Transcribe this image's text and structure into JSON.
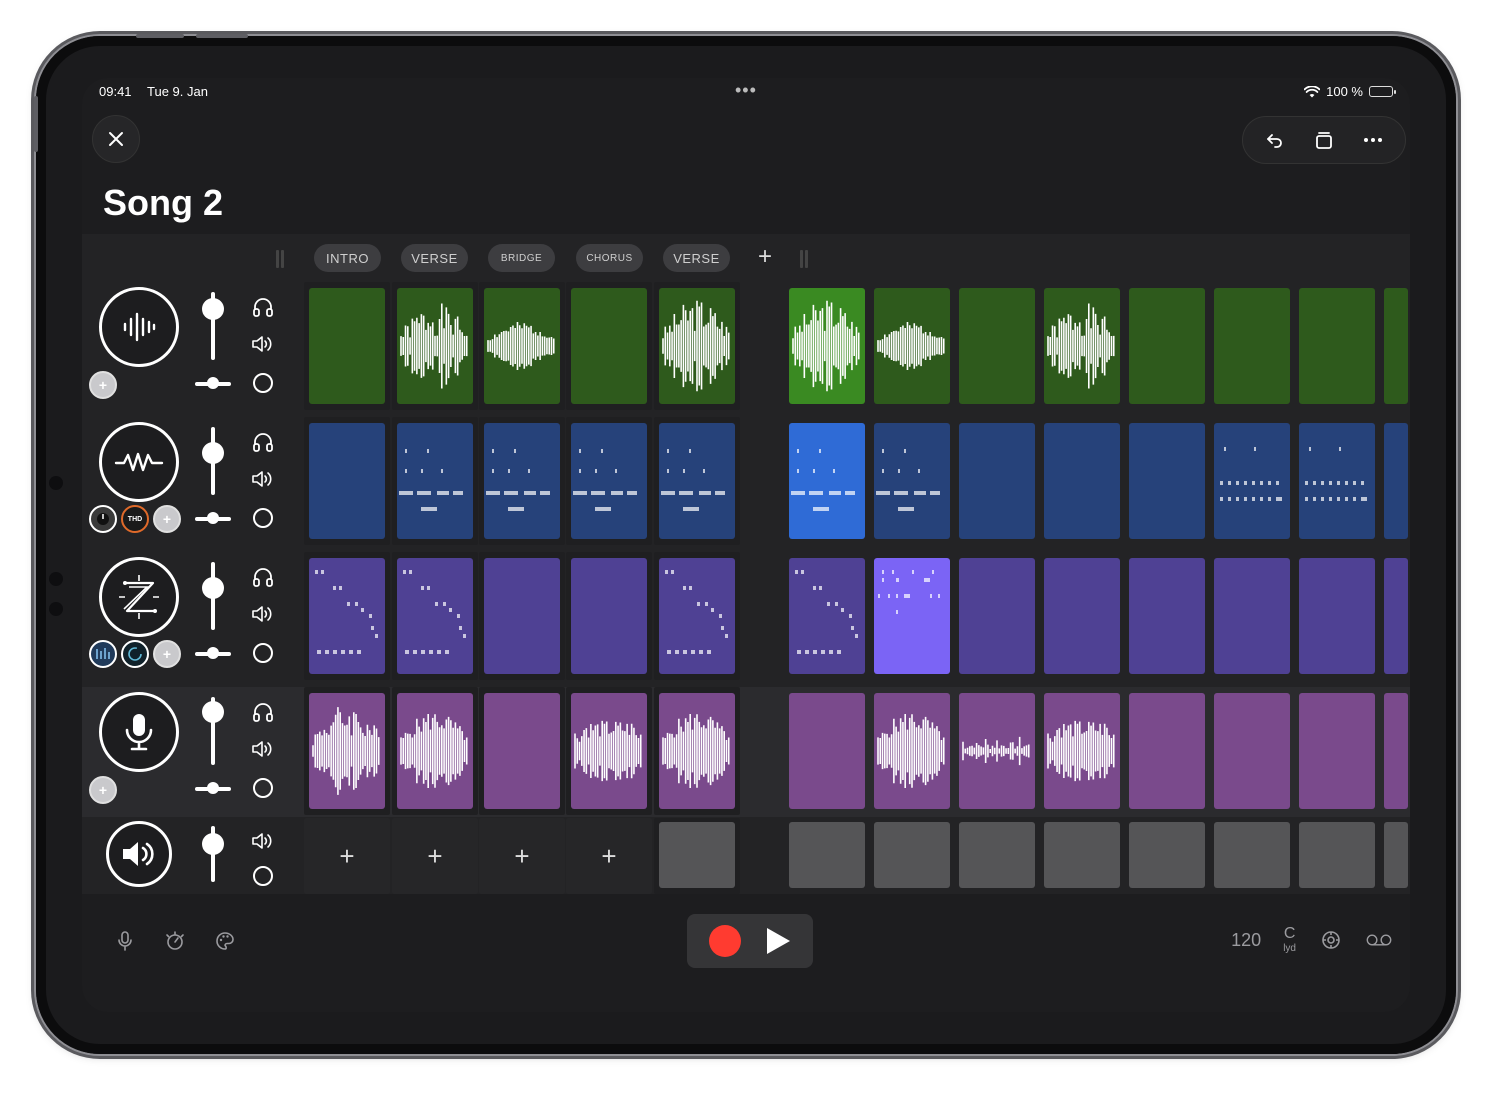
{
  "status": {
    "time": "09:41",
    "date": "Tue 9. Jan",
    "battery": "100 %"
  },
  "song": {
    "title": "Song 2"
  },
  "scenes": [
    {
      "label": "INTRO",
      "small": false
    },
    {
      "label": "VERSE",
      "small": false
    },
    {
      "label": "BRIDGE",
      "small": true
    },
    {
      "label": "CHORUS",
      "small": true
    },
    {
      "label": "VERSE",
      "small": false
    }
  ],
  "tracks": [
    {
      "id": "audio",
      "instrument_icon": "waveform-icon",
      "selected": false,
      "color": "#2e5a1c",
      "active_color": "#3a8a22",
      "kind": "wave",
      "fader": 0.75,
      "pan": 0.5,
      "fx": [
        "add"
      ],
      "clips": [
        {
          "state": "empty"
        },
        {
          "state": "wave",
          "v": 1
        },
        {
          "state": "wave",
          "v": 2
        },
        {
          "state": "empty"
        },
        {
          "state": "wave",
          "v": 3
        },
        {
          "state": "active",
          "v": 3
        },
        {
          "state": "wave",
          "v": 2
        },
        {
          "state": "empty"
        },
        {
          "state": "wave",
          "v": 1
        },
        {
          "state": "empty"
        },
        {
          "state": "empty"
        },
        {
          "state": "empty"
        },
        {
          "state": "empty"
        }
      ]
    },
    {
      "id": "synth",
      "instrument_icon": "synth-wave-icon",
      "selected": false,
      "color": "#26427a",
      "active_color": "#2f6bd6",
      "kind": "midi",
      "fader": 0.62,
      "pan": 0.5,
      "fx": [
        "knob",
        "thd",
        "add"
      ],
      "clips": [
        {
          "state": "empty"
        },
        {
          "state": "midi",
          "v": 1
        },
        {
          "state": "midi",
          "v": 1
        },
        {
          "state": "midi",
          "v": 1
        },
        {
          "state": "midi",
          "v": 1
        },
        {
          "state": "active",
          "v": 1
        },
        {
          "state": "midi",
          "v": 1
        },
        {
          "state": "empty"
        },
        {
          "state": "empty"
        },
        {
          "state": "empty"
        },
        {
          "state": "midi",
          "v": 2
        },
        {
          "state": "midi",
          "v": 2
        },
        {
          "state": "empty"
        }
      ]
    },
    {
      "id": "drums",
      "instrument_icon": "z-logo-icon",
      "selected": false,
      "color": "#4f4194",
      "active_color": "#7b64f5",
      "kind": "midi",
      "fader": 0.62,
      "pan": 0.5,
      "fx": [
        "eq",
        "ring",
        "add"
      ],
      "clips": [
        {
          "state": "midi",
          "v": 3
        },
        {
          "state": "midi",
          "v": 3
        },
        {
          "state": "empty"
        },
        {
          "state": "empty"
        },
        {
          "state": "midi",
          "v": 3
        },
        {
          "state": "midi",
          "v": 3
        },
        {
          "state": "active",
          "v": 4
        },
        {
          "state": "empty"
        },
        {
          "state": "empty"
        },
        {
          "state": "empty"
        },
        {
          "state": "empty"
        },
        {
          "state": "empty"
        },
        {
          "state": "empty"
        }
      ]
    },
    {
      "id": "vocal",
      "instrument_icon": "microphone-icon",
      "selected": true,
      "color": "#7a4a8c",
      "active_color": "#9a5bb0",
      "kind": "wave",
      "fader": 0.78,
      "pan": 0.5,
      "fx": [
        "add"
      ],
      "clips": [
        {
          "state": "wave",
          "v": 4
        },
        {
          "state": "wave",
          "v": 5
        },
        {
          "state": "empty"
        },
        {
          "state": "wave",
          "v": 6
        },
        {
          "state": "wave",
          "v": 5
        },
        {
          "state": "empty"
        },
        {
          "state": "wave",
          "v": 5
        },
        {
          "state": "wave",
          "v": 7
        },
        {
          "state": "wave",
          "v": 6
        },
        {
          "state": "empty"
        },
        {
          "state": "empty"
        },
        {
          "state": "empty"
        },
        {
          "state": "empty"
        }
      ]
    }
  ],
  "master": {
    "instrument_icon": "speaker-icon",
    "fader": 0.68,
    "clips": [
      "add",
      "add",
      "add",
      "add",
      "gray",
      "gray",
      "gray",
      "gray",
      "gray",
      "gray",
      "gray",
      "gray",
      "gray"
    ]
  },
  "footer": {
    "tempo": "120",
    "key": "C",
    "mode": "lyd"
  },
  "colors": {
    "record": "#ff3b30",
    "background": "#1d1d1f"
  }
}
